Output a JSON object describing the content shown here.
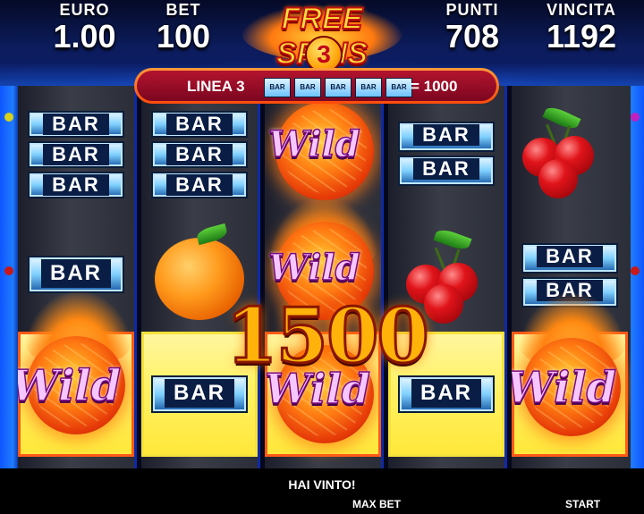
{
  "stats": {
    "euro": {
      "label": "EURO",
      "value": "1.00"
    },
    "bet": {
      "label": "BET",
      "value": "100"
    },
    "punti": {
      "label": "PUNTI",
      "value": "708"
    },
    "vincita": {
      "label": "VINCITA",
      "value": "1192"
    }
  },
  "free_spins": {
    "title": "FREE SPINS",
    "count": "3"
  },
  "line_indicator": {
    "label": "LINEA 3",
    "mini_symbol": "BAR",
    "payout": "= 1000"
  },
  "symbols": {
    "bar": "BAR",
    "wild": "Wild"
  },
  "win_amount": "1500",
  "message": "HAI VINTO!",
  "buttons": {
    "max_bet": "MAX BET",
    "start": "START"
  },
  "colors": {
    "accent_blue": "#1f7cff",
    "win_gold": "#ffb20a",
    "panel_red": "#9c0e28"
  }
}
